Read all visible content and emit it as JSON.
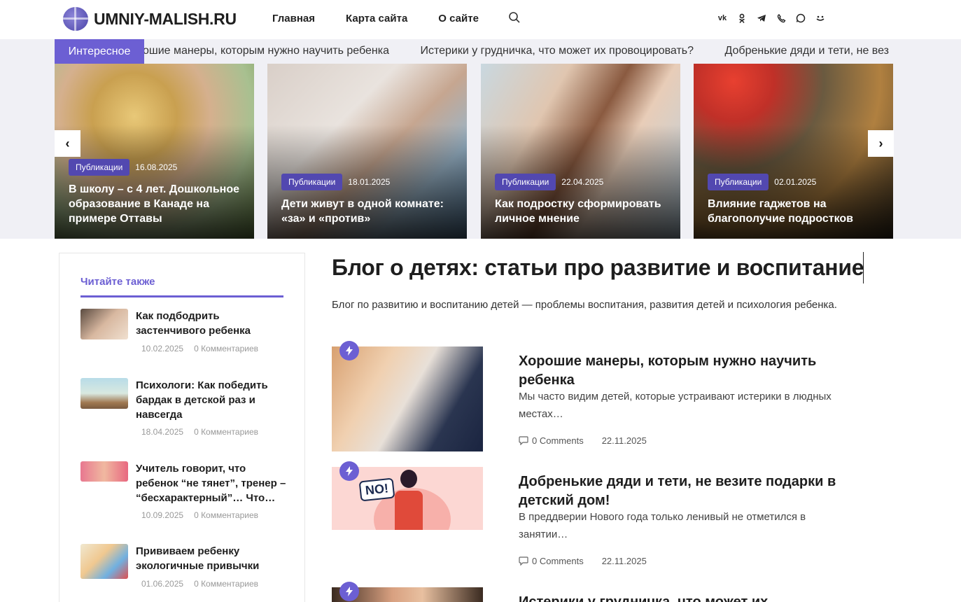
{
  "header": {
    "logo": "UMNIY-MALISH.RU",
    "nav": [
      "Главная",
      "Карта сайта",
      "О сайте"
    ],
    "social": [
      "vk",
      "ok",
      "telegram",
      "viber",
      "whatsapp",
      "yandex-zen"
    ]
  },
  "ticker": {
    "label": "Интересное",
    "items": [
      "ошие манеры, которым нужно научить ребенка",
      "Истерики у грудничка, что может их провоцировать?",
      "Добренькие дяди и тети, не вез"
    ]
  },
  "slider": {
    "cards": [
      {
        "category": "Публикации",
        "date": "16.08.2025",
        "title": "В школу – с 4 лет. Дошкольное образование в Канаде на примере Оттавы"
      },
      {
        "category": "Публикации",
        "date": "18.01.2025",
        "title": "Дети живут в одной комнате: «за» и «против»"
      },
      {
        "category": "Публикации",
        "date": "22.04.2025",
        "title": "Как подростку сформировать личное мнение"
      },
      {
        "category": "Публикации",
        "date": "02.01.2025",
        "title": "Влияние гаджетов на благополучие подростков"
      }
    ],
    "prev": "‹",
    "next": "›"
  },
  "sidebar": {
    "title": "Читайте также",
    "items": [
      {
        "title": "Как подбодрить застенчивого ребенка",
        "date": "10.02.2025",
        "comments": "0 Комментариев"
      },
      {
        "title": "Психологи: Как победить бардак в детской раз и навсегда",
        "date": "18.04.2025",
        "comments": "0 Комментариев"
      },
      {
        "title": "Учитель говорит, что ребенок “не тянет”, тренер – “бесхарактерный”… Что…",
        "date": "10.09.2025",
        "comments": "0 Комментариев"
      },
      {
        "title": "Прививаем ребенку экологичные привычки",
        "date": "01.06.2025",
        "comments": "0 Комментариев"
      }
    ]
  },
  "main": {
    "title": "Блог о детях: статьи про развитие и воспитание",
    "intro": "Блог по развитию и воспитанию детей — проблемы воспитания, развития детей и психология ребенка.",
    "posts": [
      {
        "title": "Хорошие манеры, которым нужно научить ребенка",
        "excerpt": "Мы часто видим детей, которые устраивают истерики в людных местах…",
        "comments": "0 Comments",
        "date": "22.11.2025"
      },
      {
        "title": "Добренькие дяди и тети, не везите подарки в детский дом!",
        "excerpt": "В преддверии Нового года только ленивый не отметился в занятии…",
        "comments": "0 Comments",
        "date": "22.11.2025",
        "image_text": "NO!"
      },
      {
        "title": "Истерики у грудничка, что может их"
      }
    ]
  },
  "colors": {
    "accent": "#6c5fd3",
    "badge": "#5248b0"
  }
}
